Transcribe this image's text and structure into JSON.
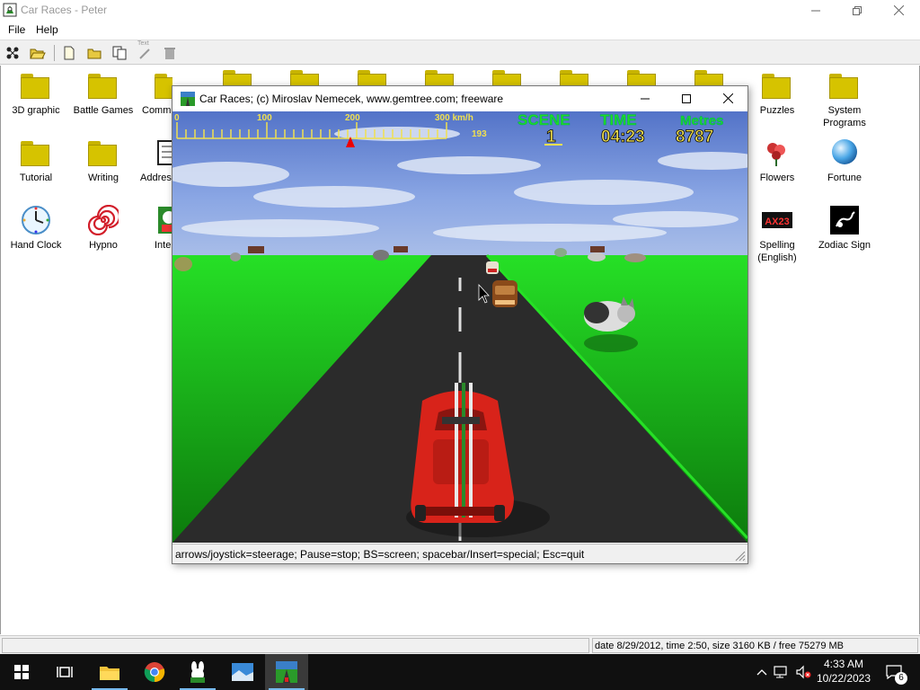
{
  "window": {
    "title": "Car Races - Peter"
  },
  "menu": [
    {
      "label": "File"
    },
    {
      "label": "Help"
    }
  ],
  "toolbar": {
    "text_label": "Text"
  },
  "desktop_icons": [
    {
      "label": "3D graphic",
      "icon": "folder-icon"
    },
    {
      "label": "Battle Games",
      "icon": "folder-icon"
    },
    {
      "label": "Commu",
      "icon": "folder-icon"
    },
    {
      "label": "Puzzles",
      "icon": "folder-icon"
    },
    {
      "label": "System Programs",
      "icon": "folder-icon"
    },
    {
      "label": "Tutorial",
      "icon": "folder-icon"
    },
    {
      "label": "Writing",
      "icon": "folder-icon"
    },
    {
      "label": "Addres",
      "icon": "address-book-icon"
    },
    {
      "label": "Flowers",
      "icon": "flowers-icon"
    },
    {
      "label": "Fortune",
      "icon": "crystal-ball-icon"
    },
    {
      "label": "Hand Clock",
      "icon": "clock-icon"
    },
    {
      "label": "Hypno",
      "icon": "spiral-icon"
    },
    {
      "label": "Inter",
      "icon": "inter-icon"
    },
    {
      "label": "Spelling (English)",
      "icon": "spelling-icon"
    },
    {
      "label": "Zodiac Sign",
      "icon": "scorpion-icon"
    }
  ],
  "game_window": {
    "title": "Car Races;   (c) Miroslav Nemecek, www.gemtree.com;   freeware",
    "status_text": "arrows/joystick=steerage;  Pause=stop;  BS=screen;  spacebar/Insert=special;  Esc=quit"
  },
  "hud": {
    "speed_scale": [
      "0",
      "100",
      "200",
      "300 km/h"
    ],
    "speed": "193",
    "speed_value": 193,
    "speed_max": 300,
    "scene_label": "SCENE",
    "scene": "1",
    "time_label": "TIME",
    "time": "04:23",
    "metres_label": "Metres",
    "metres": "8787"
  },
  "statusbar": {
    "info": "date 8/29/2012, time 2:50, size 3160 KB / free 75279 MB"
  },
  "taskbar": {
    "time": "4:33 AM",
    "date": "10/22/2023",
    "notification_count": "6"
  },
  "colors": {
    "sky": "#6f8fd8",
    "grass": "#1fb51f",
    "road": "#2b2b2b",
    "hud_green": "#22dd22",
    "hud_yellow": "#f0e050",
    "car_red": "#d8231a"
  }
}
